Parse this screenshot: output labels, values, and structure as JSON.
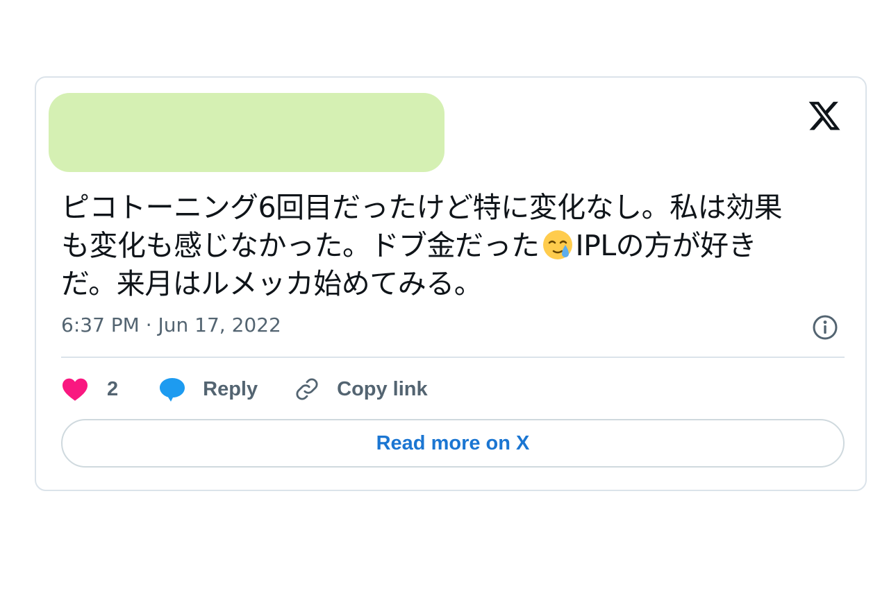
{
  "colors": {
    "redaction": "#d5f0b3",
    "heart": "#f91880",
    "reply_bubble": "#1d9bf0",
    "link": "#1b76d2",
    "muted": "#536471",
    "border": "#dbe3ea"
  },
  "header": {
    "author_redacted": true,
    "logo_icon": "x-logo-icon"
  },
  "tweet": {
    "text_part1": "ピコトーニング6回目だったけど特に変化なし。私は効果\nも変化も感じなかった。ドブ金だった",
    "emoji_icon": "face-holding-back-tears-emoji",
    "text_part2": "IPLの方が好き\nだ。来月はルメッカ始めてみる。",
    "timestamp": "6:37 PM · Jun 17, 2022",
    "info_icon": "info-icon"
  },
  "actions": {
    "like_icon": "heart-icon",
    "like_count": "2",
    "reply_icon": "reply-bubble-icon",
    "reply_label": "Reply",
    "copy_icon": "link-icon",
    "copy_label": "Copy link"
  },
  "read_more_label": "Read more on X"
}
